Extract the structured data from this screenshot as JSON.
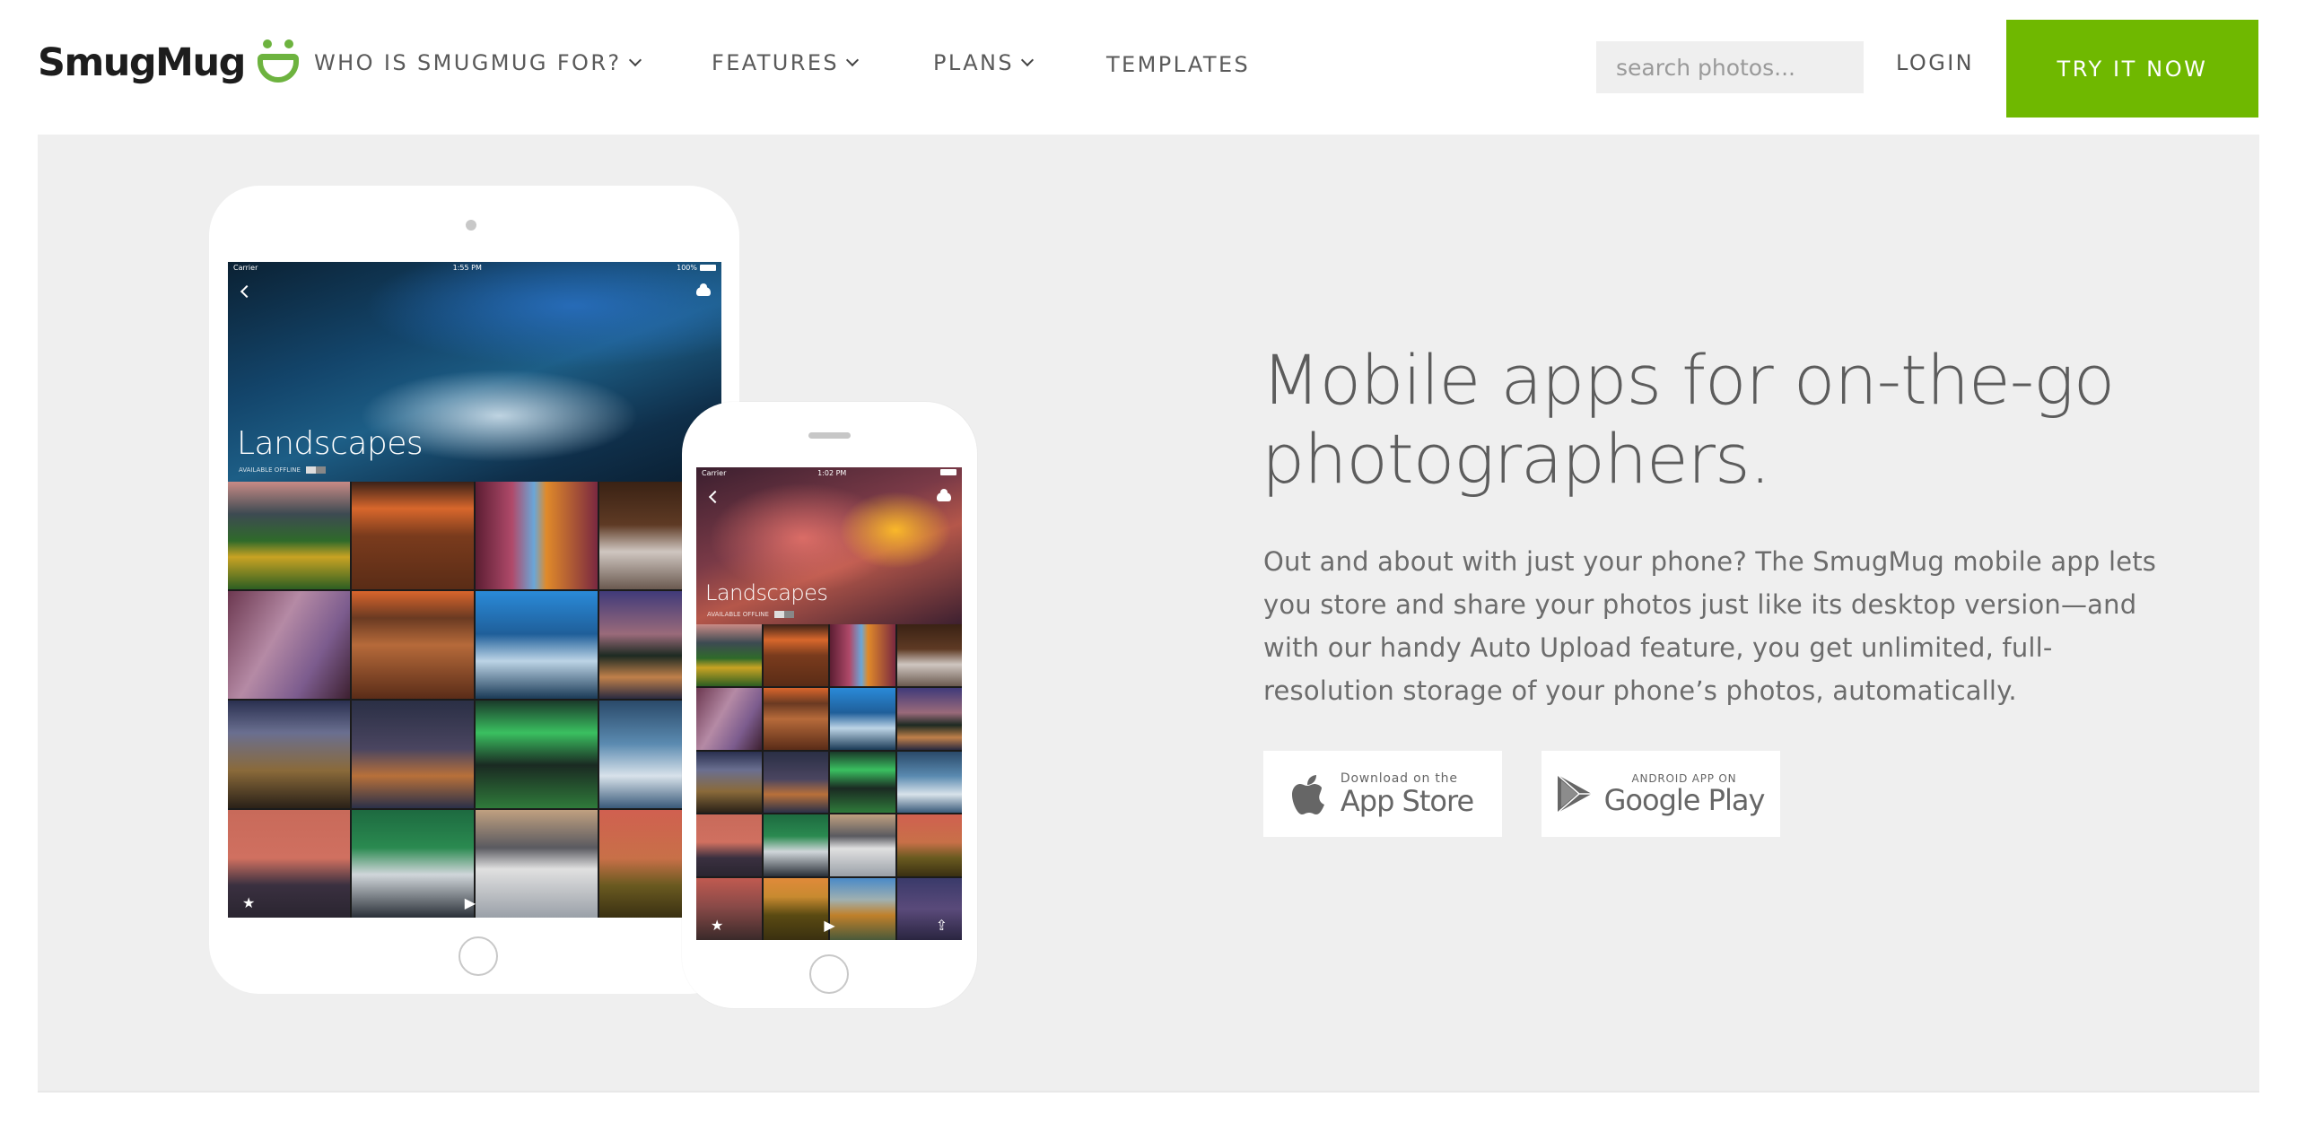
{
  "header": {
    "logo_text": "SmugMug",
    "nav": [
      {
        "label": "WHO IS SMUGMUG FOR?",
        "dropdown": true
      },
      {
        "label": "FEATURES",
        "dropdown": true
      },
      {
        "label": "PLANS",
        "dropdown": true
      },
      {
        "label": "TEMPLATES",
        "dropdown": false
      }
    ],
    "search_placeholder": "search photos...",
    "login_label": "LOGIN",
    "cta_label": "TRY IT NOW"
  },
  "colors": {
    "brand_green": "#6fb800",
    "logo_green": "#6db33f",
    "hero_bg": "#efefef"
  },
  "hero": {
    "headline": "Mobile apps for on-the-go photographers.",
    "body": "Out and about with just your phone? The SmugMug mobile app lets you store and share your photos just like its desktop version—and with our handy Auto Upload feature, you get unlimited, full-resolution storage of your phone’s photos, automatically.",
    "badges": {
      "appstore": {
        "small": "Download on the",
        "big": "App Store"
      },
      "googleplay": {
        "small": "ANDROID APP ON",
        "big": "Google Play"
      }
    }
  },
  "tablet_screen": {
    "carrier": "Carrier",
    "time": "1:55 PM",
    "battery": "100%",
    "album_title": "Landscapes",
    "offline_label": "AVAILABLE OFFLINE"
  },
  "phone_screen": {
    "carrier": "Carrier",
    "time": "1:02 PM",
    "album_title": "Landscapes",
    "offline_label": "AVAILABLE OFFLINE"
  },
  "thumbnails": {
    "tablet": [
      "sunflowers-lake",
      "red-canyon",
      "antelope-slot",
      "river-rocks",
      "purple-slot",
      "hoodoos",
      "ice-cave-river",
      "lake-dusk",
      "milky-way-arch",
      "milky-way-mountains",
      "aurora-lake",
      "ice-snow",
      "sunset-mountains",
      "aurora-waterfall",
      "kirkjufell",
      "sunflower-sunset"
    ],
    "phone": [
      "sunflowers-lake",
      "red-canyon",
      "antelope-slot",
      "river-rocks",
      "purple-slot",
      "hoodoos",
      "ice-cave-river",
      "lake-dusk",
      "milky-way-arch",
      "milky-way-mountains",
      "aurora-lake",
      "ice-snow",
      "sunset-mountains",
      "aurora-waterfall",
      "kirkjufell",
      "sunflower-sunset",
      "sunset-peak",
      "sunflower-field",
      "autumn-forest",
      "night-grass"
    ]
  }
}
